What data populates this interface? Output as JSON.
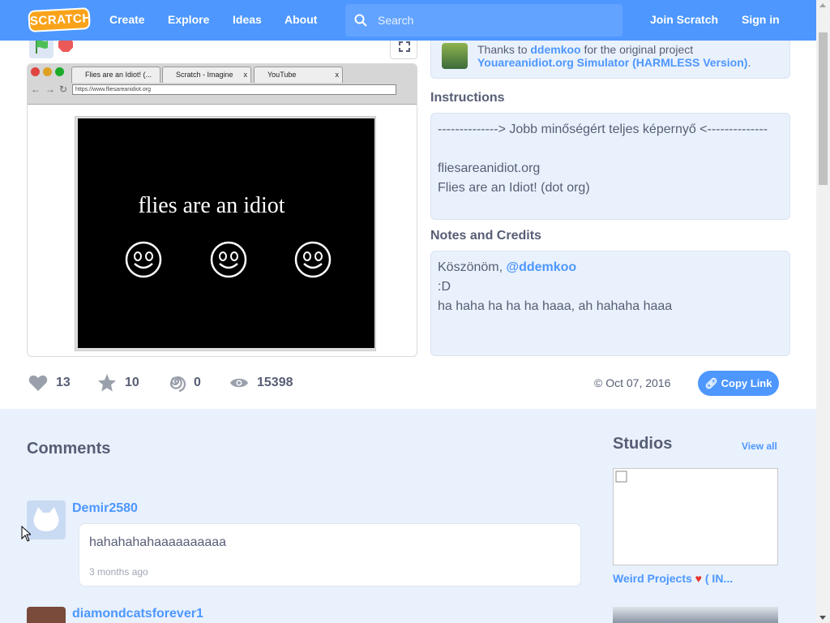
{
  "nav": {
    "logo": "SCRATCH",
    "links": [
      "Create",
      "Explore",
      "Ideas",
      "About"
    ],
    "search_placeholder": "Search",
    "join": "Join Scratch",
    "signin": "Sign in"
  },
  "stage": {
    "tabs": [
      "Flies are an Idiot! (...",
      "Scratch - Imagine",
      "YouTube"
    ],
    "address": "https://www.fliesareanidiot.org",
    "title": "flies are an idiot"
  },
  "credits": {
    "prefix": "Thanks to ",
    "user": "ddemkoo",
    "suffix": " for the original project",
    "project": "Youareanidiot.org Simulator (HARMLESS Version)",
    "end": "."
  },
  "instructions": {
    "title": "Instructions",
    "lines": [
      "--------------> Jobb minőségért teljes képernyő <--------------",
      "",
      "fliesareanidiot.org",
      "Flies are an Idiot! (dot org)"
    ]
  },
  "notes": {
    "title": "Notes and Credits",
    "line1_prefix": "Köszönöm, ",
    "line1_mention": "@ddemkoo",
    "line2": ":D",
    "line3": "ha haha ha ha ha haaa, ah hahaha haaa"
  },
  "stats": {
    "loves": "13",
    "favorites": "10",
    "remixes": "0",
    "views": "15398",
    "date": "Oct 07, 2016",
    "copy_link": "Copy Link"
  },
  "comments": {
    "title": "Comments",
    "items": [
      {
        "user": "Demir2580",
        "text": "hahahahahaaaaaaaaaa",
        "time": "3 months ago"
      },
      {
        "user": "diamondcatsforever1"
      }
    ]
  },
  "studios": {
    "title": "Studios",
    "view_all": "View all",
    "items": [
      {
        "name": "Weird Projects",
        "name_suffix": " ( IN..."
      }
    ]
  },
  "colors": {
    "brand": "#4d97ff",
    "logo": "#f9a31a",
    "panel": "#e9f1fc",
    "heart": "#e5332a"
  }
}
